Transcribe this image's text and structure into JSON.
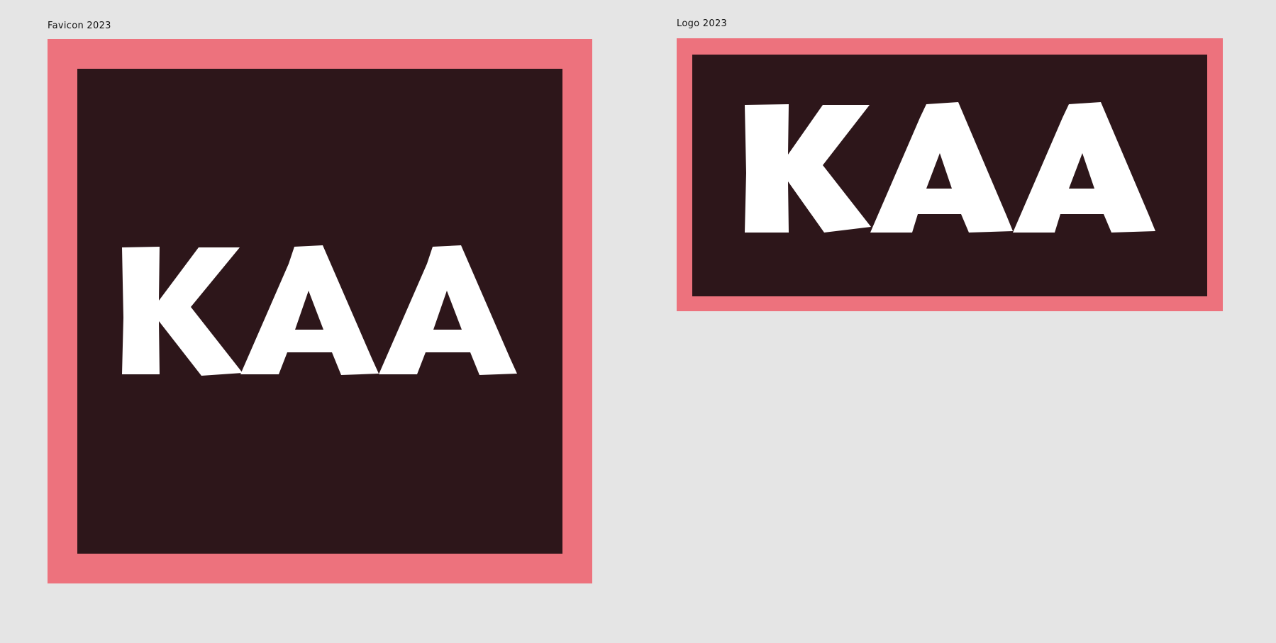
{
  "canvas": {
    "background": "#e5e5e5"
  },
  "frames": [
    {
      "id": "favicon",
      "label": "Favicon 2023",
      "wordmark": "KAA"
    },
    {
      "id": "logo",
      "label": "Logo 2023",
      "wordmark": "KAA"
    }
  ],
  "colors": {
    "border": "#ed727d",
    "panel": "#2d161a",
    "letters": "#ffffff"
  }
}
